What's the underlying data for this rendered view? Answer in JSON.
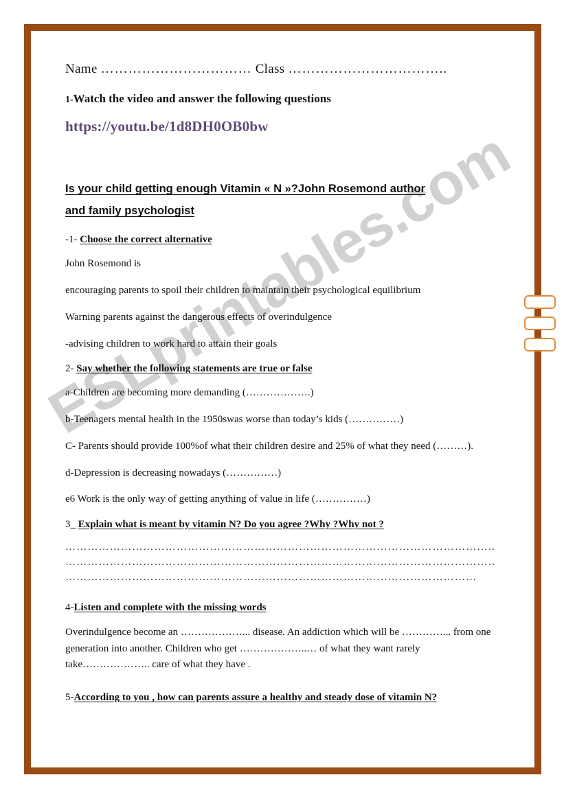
{
  "document": {
    "header": {
      "name_label": "Name",
      "name_dots": "……………………………",
      "class_label": "Class",
      "class_dots": "…………………………….."
    },
    "task1": {
      "number": "1-",
      "text": "Watch the video and answer the following questions",
      "url": "https://youtu.be/1d8DH0OB0bw"
    },
    "title": {
      "line1": "Is your child getting enough  Vitamin « N »?John Rosemond author",
      "line2": "and family psychologist"
    },
    "task_mc": {
      "number": "-1- ",
      "heading": "Choose the correct alternative",
      "stem": "John Rosemond is",
      "options": [
        "encouraging parents to spoil their children to maintain their psychological equilibrium",
        "Warning parents against  the dangerous effects of overindulgence",
        "-advising children to work hard to attain their goals"
      ]
    },
    "task_tf": {
      "number": "2- ",
      "heading": "Say whether the following statements are  true or false",
      "statements": [
        "a-Children are becoming more demanding  (……………….)",
        "b-Teenagers mental health in the 1950swas worse than today’s kids (……………)",
        "C- Parents should  provide 100%of  what their  children desire and 25% of what they need (………).",
        "d-Depression is decreasing nowadays (……………)",
        "e6 Work is the only way of getting anything of value in life (……………)"
      ]
    },
    "task3": {
      "number": "3_ ",
      "heading": "Explain what is meant by vitamin N? Do you agree ?Why ?Why not ?",
      "answer_lines": [
        "……………………………………………………………………………………………………………",
        "……………………………………………………………………………………………………………",
        "……………………………………………………………………………………………………………"
      ]
    },
    "task4": {
      "number": "4-",
      "heading": "Listen and complete with the missing words",
      "paragraph": "Overindulgence become an ………………... disease. An addiction  which will be …………... from one generation into another. Children  who get ………………..… of what they want rarely take……………….. care of what they have ."
    },
    "task5": {
      "number": "5-",
      "heading": "According to you , how can parents assure a healthy and steady dose of vitamin N?"
    },
    "watermark": "ESLprintables.com",
    "colors": {
      "frame": "#9a4a15",
      "url": "#5f4b7a",
      "checkbox": "#e08a3c",
      "watermark": "#c9c9c9"
    }
  }
}
